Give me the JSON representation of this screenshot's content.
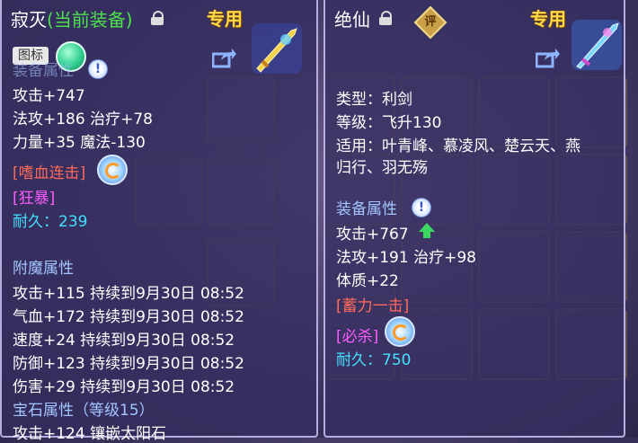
{
  "left": {
    "name": "寂灭",
    "equipped_tag": "(当前装备)",
    "exclusive": "专用",
    "icon_toggle_label": "图标",
    "partial_header": "装备属性",
    "stats": [
      "攻击+747",
      "法攻+186 治疗+78",
      "力量+35 魔法-130"
    ],
    "skill_1": "[嗜血连击]",
    "skill_2": "[狂暴]",
    "durability": "耐久：239",
    "enchant_header": "附魔属性",
    "enchants": [
      "攻击+115 持续到9月30日 08:52",
      "气血+172 持续到9月30日 08:52",
      "速度+24 持续到9月30日 08:52",
      "防御+123 持续到9月30日 08:52",
      "伤害+29 持续到9月30日 08:52"
    ],
    "gem_header": "宝石属性（等级15）",
    "gem_line": "攻击+124 镶嵌太阳石"
  },
  "right": {
    "name": "绝仙",
    "rate_badge": "评",
    "exclusive": "专用",
    "type": "类型：利剑",
    "level": "等级：飞升130",
    "suitable_1": "适用：叶青峰、慕凌风、楚云天、燕",
    "suitable_2": "归行、羽无殇",
    "attr_header": "装备属性",
    "stats": [
      "攻击+767",
      "法攻+191 治疗+98",
      "体质+22"
    ],
    "skill_1": "[蓄力一击]",
    "skill_2": "[必杀]",
    "durability": "耐久：750"
  },
  "colors": {
    "title_green": "#4de04d",
    "exclusive_gold": "#ffd94a",
    "header_blue": "#a3c6ff",
    "skill_red": "#ff6a5a",
    "skill_magenta": "#ff5bff",
    "durability_cyan": "#44e0ff"
  }
}
